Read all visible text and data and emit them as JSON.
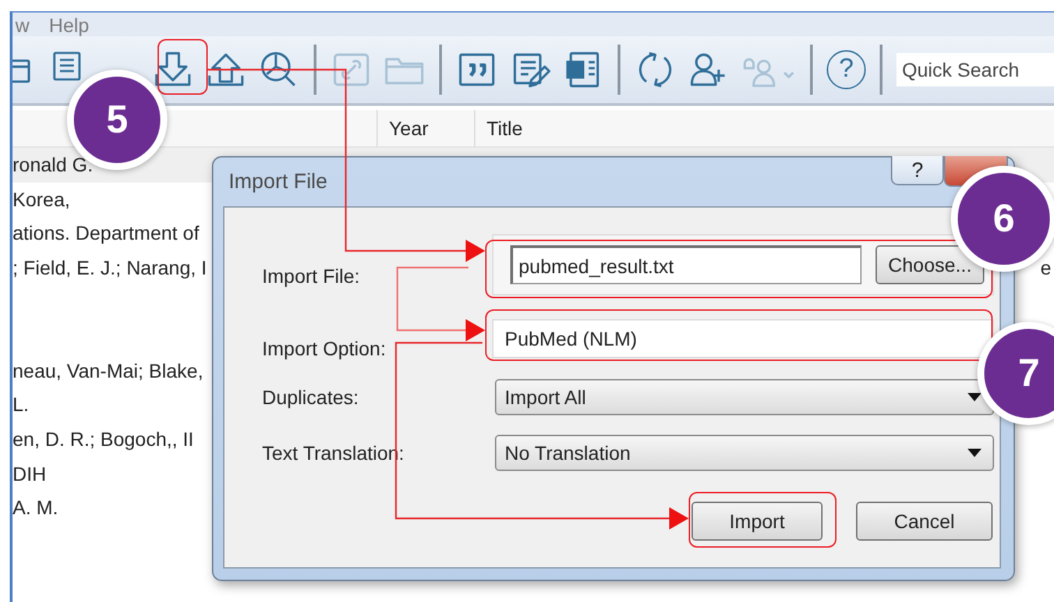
{
  "menu": [
    "w",
    "Help"
  ],
  "toolbar": [
    {
      "disabled": false
    },
    {
      "disabled": false
    },
    {
      "disabled": false
    },
    {
      "disabled": false
    },
    {
      "disabled": false
    },
    {
      "disabled": true
    },
    {
      "disabled": true
    },
    {
      "disabled": false
    },
    {
      "disabled": false
    },
    {
      "disabled": false
    },
    {
      "disabled": false
    },
    {
      "disabled": false
    },
    {
      "disabled": true
    },
    {
      "disabled": false,
      "glyph": "?"
    }
  ],
  "search": {
    "placeholder": "Quick Search"
  },
  "columns": [
    "Year",
    "Title"
  ],
  "rows": [
    {
      "author": "ronald G.",
      "selected": true
    },
    {
      "author": "Korea,",
      "selected": false
    },
    {
      "author": "ations. Department of",
      "selected": false
    },
    {
      "author": "; Field, E. J.; Narang, I",
      "title": "e",
      "selected": false
    },
    {
      "selected": false
    },
    {
      "selected": false
    },
    {
      "author": "neau, Van-Mai; Blake,",
      "selected": false
    },
    {
      "author": "L.",
      "selected": false
    },
    {
      "author": "en, D. R.; Bogoch,, II",
      "selected": false
    },
    {
      "author": "DIH",
      "selected": false
    },
    {
      "author": "A. M.",
      "selected": false
    }
  ],
  "dialog": {
    "title": "Import File",
    "help": "?",
    "fields": [
      {
        "kind": "file",
        "label": "Import File:",
        "value": "pubmed_result.txt",
        "button": "Choose..."
      },
      {
        "kind": "text",
        "label": "Import Option:",
        "value": "PubMed (NLM)"
      },
      {
        "kind": "select",
        "label": "Duplicates:",
        "value": "Import All"
      },
      {
        "kind": "select",
        "label": "Text Translation:",
        "value": "No Translation"
      }
    ],
    "buttons": [
      "Import",
      "Cancel"
    ]
  },
  "callouts": [
    "5",
    "6",
    "7"
  ]
}
